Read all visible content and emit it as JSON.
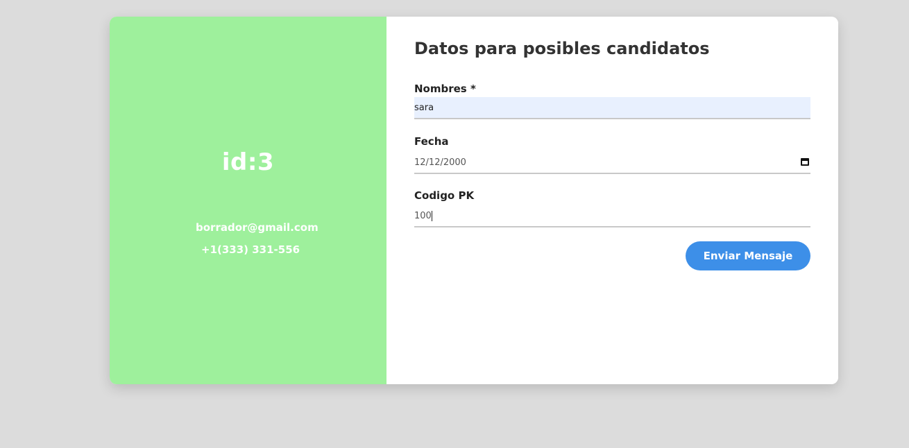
{
  "left_panel": {
    "id_label": "id:3",
    "email": "borrador@gmail.com",
    "phone": "+1(333) 331-556",
    "background_color": "#9ef09c"
  },
  "form": {
    "title": "Datos para posibles candidatos",
    "fields": [
      {
        "label": "Nombres *",
        "value": "sara"
      },
      {
        "label": "Fecha",
        "value": "12/12/2000",
        "icon": "calendar-icon"
      },
      {
        "label": "Codigo PK",
        "value": "100"
      }
    ],
    "submit_label": "Enviar Mensaje",
    "submit_color": "#3d8fe8"
  }
}
